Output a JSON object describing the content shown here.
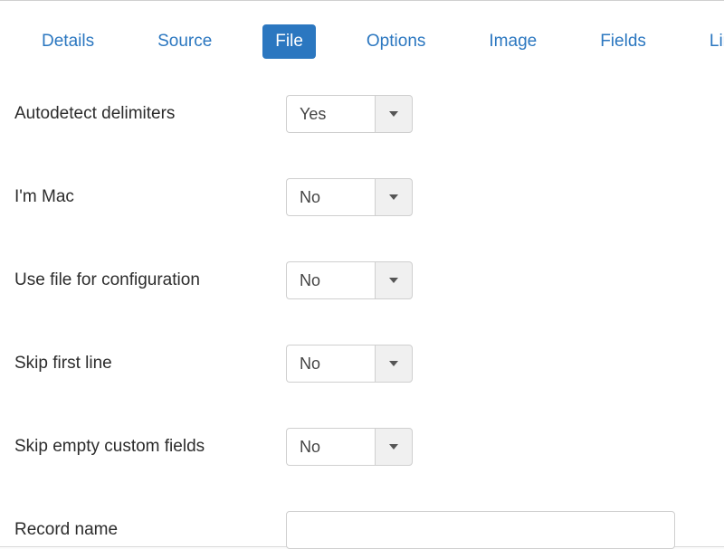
{
  "tabs": {
    "details": "Details",
    "source": "Source",
    "file": "File",
    "options": "Options",
    "image": "Image",
    "fields": "Fields",
    "limit": "Limit"
  },
  "form": {
    "autodetect_delimiters": {
      "label": "Autodetect delimiters",
      "value": "Yes"
    },
    "im_mac": {
      "label": "I'm Mac",
      "value": "No"
    },
    "use_file_config": {
      "label": "Use file for configuration",
      "value": "No"
    },
    "skip_first_line": {
      "label": "Skip first line",
      "value": "No"
    },
    "skip_empty_custom": {
      "label": "Skip empty custom fields",
      "value": "No"
    },
    "record_name": {
      "label": "Record name",
      "value": ""
    }
  }
}
